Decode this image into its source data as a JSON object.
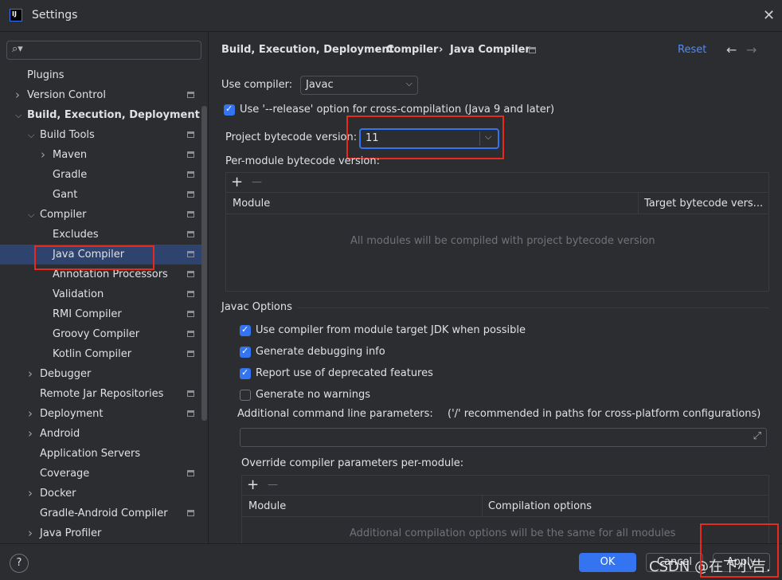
{
  "window": {
    "title": "Settings",
    "icon": "IJ"
  },
  "search": {
    "placeholder": ""
  },
  "sidebar": [
    {
      "label": "Plugins",
      "level": 0,
      "chevron": "",
      "gear": false
    },
    {
      "label": "Version Control",
      "level": 0,
      "chevron": ">",
      "gear": true
    },
    {
      "label": "Build, Execution, Deployment",
      "level": 0,
      "chevron": "v",
      "gear": false,
      "bold": true
    },
    {
      "label": "Build Tools",
      "level": 1,
      "chevron": "v",
      "gear": true
    },
    {
      "label": "Maven",
      "level": 2,
      "chevron": ">",
      "gear": true
    },
    {
      "label": "Gradle",
      "level": 2,
      "chevron": "",
      "gear": true
    },
    {
      "label": "Gant",
      "level": 2,
      "chevron": "",
      "gear": true
    },
    {
      "label": "Compiler",
      "level": 1,
      "chevron": "v",
      "gear": true
    },
    {
      "label": "Excludes",
      "level": 2,
      "chevron": "",
      "gear": true
    },
    {
      "label": "Java Compiler",
      "level": 2,
      "chevron": "",
      "gear": true,
      "selected": true
    },
    {
      "label": "Annotation Processors",
      "level": 2,
      "chevron": "",
      "gear": true
    },
    {
      "label": "Validation",
      "level": 2,
      "chevron": "",
      "gear": true
    },
    {
      "label": "RMI Compiler",
      "level": 2,
      "chevron": "",
      "gear": true
    },
    {
      "label": "Groovy Compiler",
      "level": 2,
      "chevron": "",
      "gear": true
    },
    {
      "label": "Kotlin Compiler",
      "level": 2,
      "chevron": "",
      "gear": true
    },
    {
      "label": "Debugger",
      "level": 1,
      "chevron": ">",
      "gear": false
    },
    {
      "label": "Remote Jar Repositories",
      "level": 1,
      "chevron": "",
      "gear": true
    },
    {
      "label": "Deployment",
      "level": 1,
      "chevron": ">",
      "gear": true
    },
    {
      "label": "Android",
      "level": 1,
      "chevron": ">",
      "gear": false
    },
    {
      "label": "Application Servers",
      "level": 1,
      "chevron": "",
      "gear": false
    },
    {
      "label": "Coverage",
      "level": 1,
      "chevron": "",
      "gear": true
    },
    {
      "label": "Docker",
      "level": 1,
      "chevron": ">",
      "gear": false
    },
    {
      "label": "Gradle-Android Compiler",
      "level": 1,
      "chevron": "",
      "gear": true
    },
    {
      "label": "Java Profiler",
      "level": 1,
      "chevron": ">",
      "gear": false
    }
  ],
  "breadcrumb": {
    "items": [
      "Build, Execution, Deployment",
      "Compiler",
      "Java Compiler"
    ],
    "sep": "›",
    "reset": "Reset",
    "back": "←",
    "forward": "→"
  },
  "compiler": {
    "label": "Use compiler:",
    "value": "Javac"
  },
  "release_option": {
    "label": "Use '--release' option for cross-compilation (Java 9 and later)",
    "checked": true
  },
  "bytecode": {
    "label": "Project bytecode version:",
    "value": "11"
  },
  "per_module": {
    "label": "Per-module bytecode version:",
    "add": "+",
    "remove": "—",
    "col_module": "Module",
    "col_target": "Target bytecode vers...",
    "empty": "All modules will be compiled with project bytecode version"
  },
  "javac": {
    "title": "Javac Options",
    "options": [
      {
        "label": "Use compiler from module target JDK when possible",
        "checked": true
      },
      {
        "label": "Generate debugging info",
        "checked": true
      },
      {
        "label": "Report use of deprecated features",
        "checked": true
      },
      {
        "label": "Generate no warnings",
        "checked": false
      }
    ],
    "additional_label": "Additional command line parameters:",
    "additional_hint": "('/' recommended in paths for cross-platform configurations)",
    "additional_value": ""
  },
  "override": {
    "label": "Override compiler parameters per-module:",
    "add": "+",
    "remove": "—",
    "col_module": "Module",
    "col_options": "Compilation options",
    "empty": "Additional compilation options will be the same for all modules"
  },
  "footer": {
    "help": "?",
    "ok": "OK",
    "cancel": "Cancel",
    "apply": "Apply"
  },
  "watermark": "CSDN @在下小吉.",
  "colors": {
    "accent": "#3574f0",
    "highlight": "#e8291c",
    "selection": "#2e436e"
  }
}
